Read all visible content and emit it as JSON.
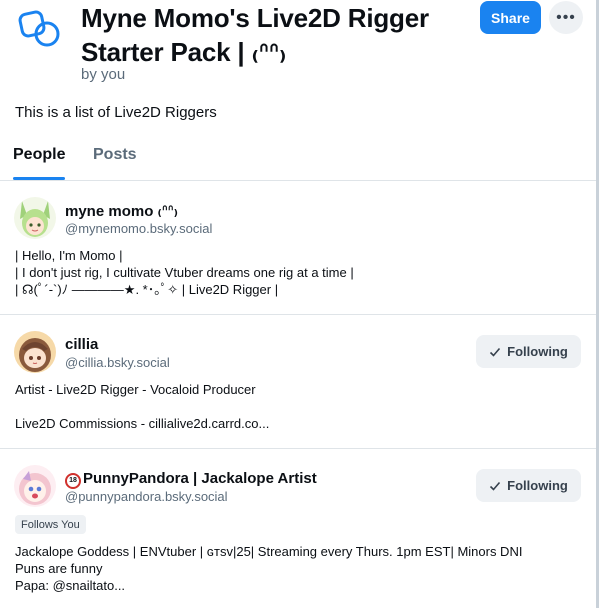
{
  "header": {
    "title": "Myne Momo's Live2D Rigger Starter Pack | ( ͡° ͜ʖ ͡°)",
    "title_text": "Myne Momo's Live2D Rigger Starter Pack | ₍ᐢᐢ₎",
    "byline": "by you",
    "share_label": "Share",
    "more_label": "•••",
    "logo_icon": "starter-pack-icon"
  },
  "description": "This is a list of Live2D Riggers",
  "tabs": [
    {
      "label": "People",
      "active": true
    },
    {
      "label": "Posts",
      "active": false
    }
  ],
  "profiles": [
    {
      "name": "myne momo ₍ᐢᐢ₎",
      "handle": "@mynemomo.bsky.social",
      "bio": "| Hello, I'm Momo |\n| I don't just rig, I cultivate Vtuber dreams one rig at a time |\n| ☊(ﾟ´-`)ﾉ ————★. *･｡ﾟ✧ | Live2D Rigger |",
      "following": false
    },
    {
      "name": "cillia",
      "handle": "@cillia.bsky.social",
      "bio": "Artist - Live2D Rigger - Vocaloid Producer\n\nLive2D Commissions - cillialive2d.carrd.co...",
      "following": true,
      "follow_label": "Following"
    },
    {
      "name": "PunnyPandora | Jackalope Artist",
      "age_badge": "18",
      "handle": "@punnypandora.bsky.social",
      "badge": "Follows You",
      "bio": "Jackalope Goddess | ENVtuber |  ɢᴛsᴠ|25| Streaming every Thurs. 1pm EST| Minors DNI\nPuns are funny\nPapa: @snailtato...",
      "following": true,
      "follow_label": "Following"
    }
  ],
  "colors": {
    "accent": "#1a83f0",
    "muted_text": "#5b6b7a",
    "button_bg": "#eef1f4",
    "divider": "#dfe4e8"
  }
}
